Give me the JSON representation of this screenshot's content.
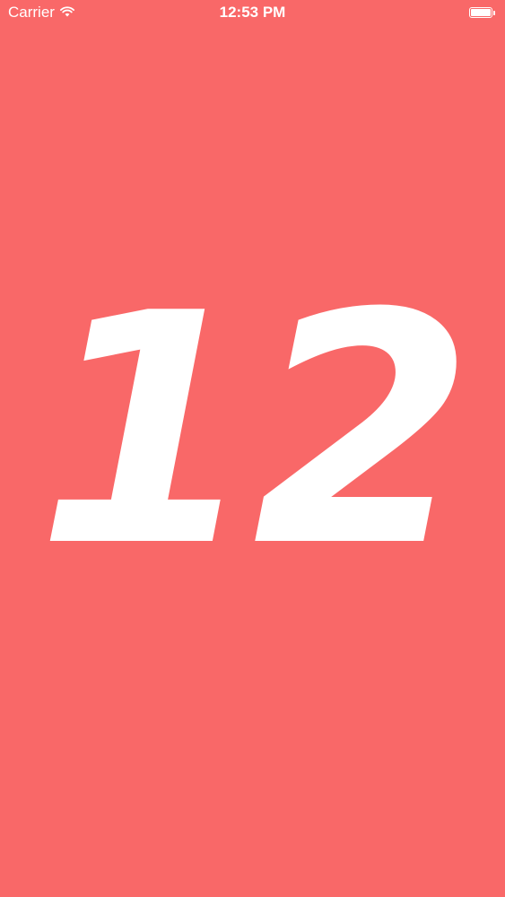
{
  "status_bar": {
    "carrier": "Carrier",
    "time": "12:53 PM",
    "wifi_icon": "wifi-icon",
    "battery_icon": "battery-icon"
  },
  "main": {
    "number": "12"
  },
  "colors": {
    "background": "#f96868",
    "foreground": "#ffffff"
  }
}
